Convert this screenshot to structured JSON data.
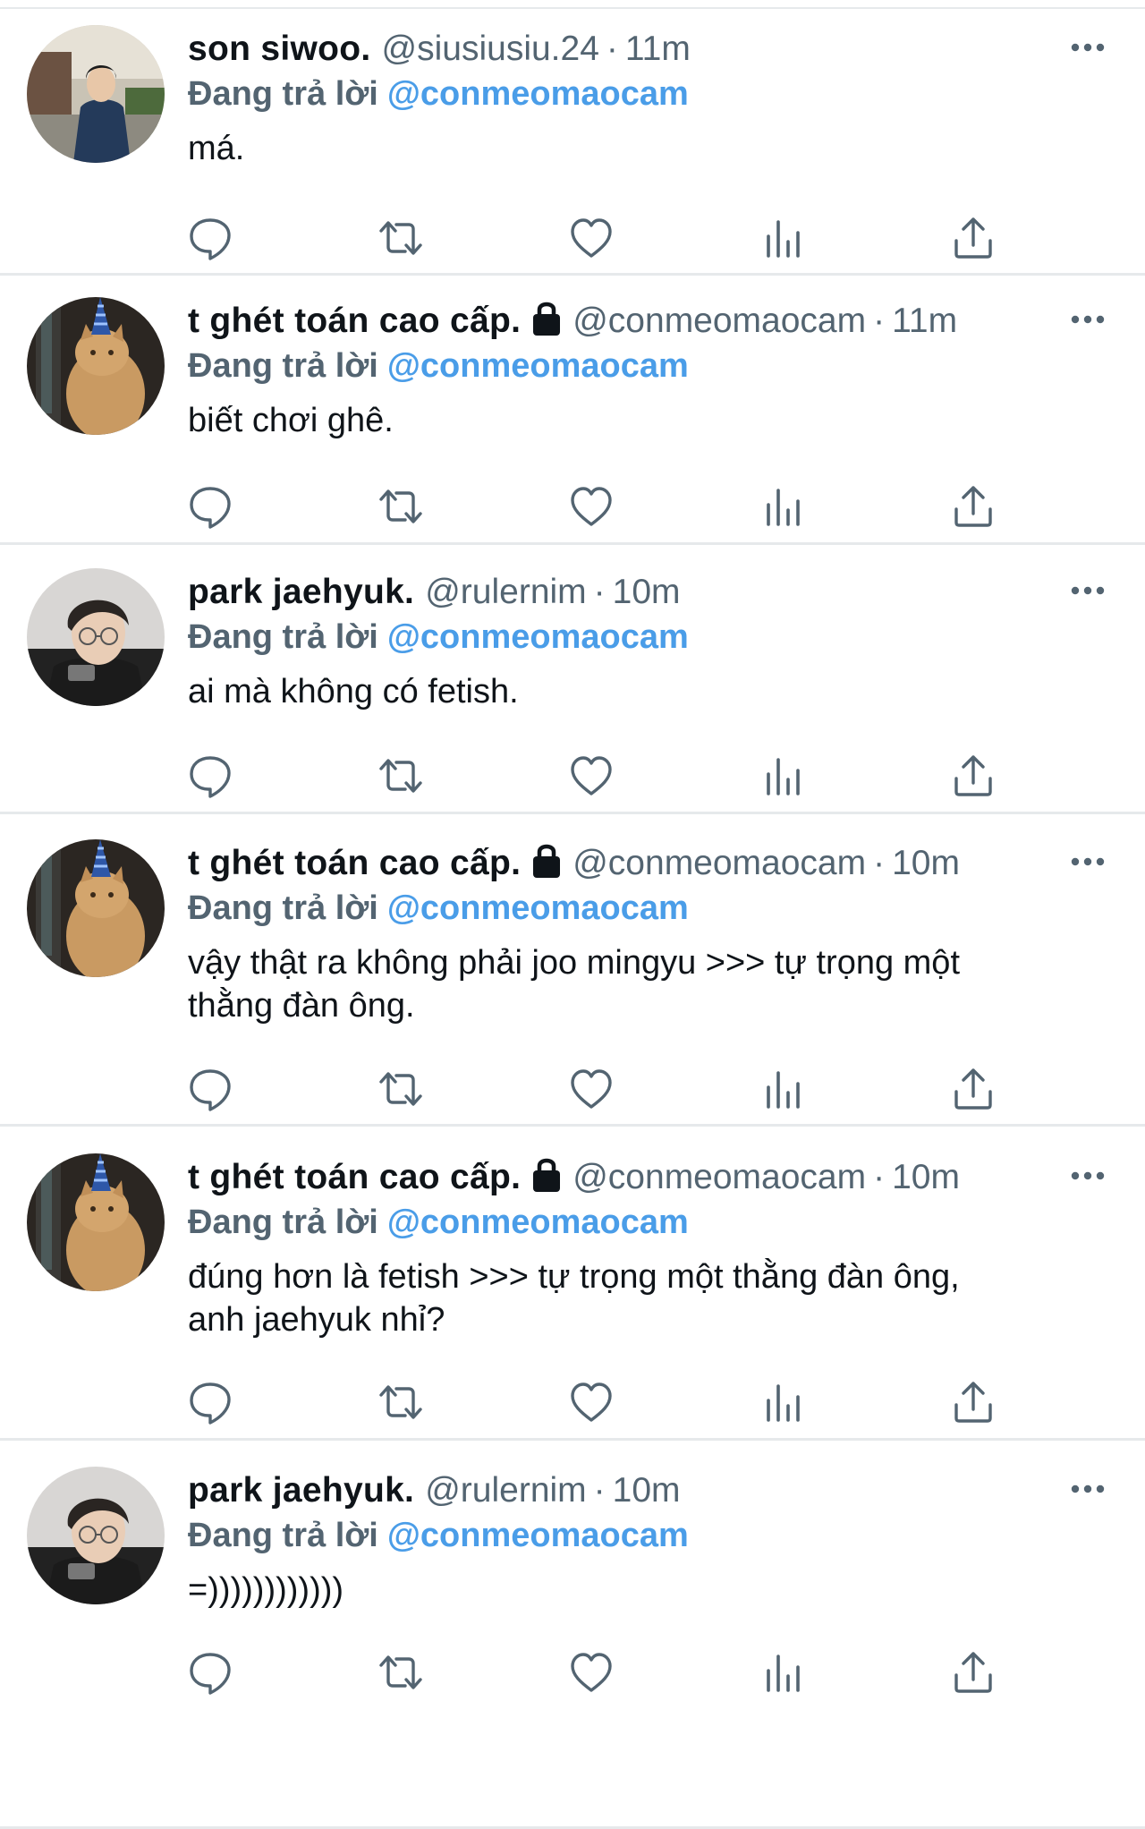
{
  "colors": {
    "link": "#4a9de8",
    "secondary_text": "#536471",
    "primary_text": "#0f1419",
    "icon": "#536471",
    "divider": "#e6e9eb"
  },
  "icons": {
    "more": "more-options-icon",
    "lock": "lock-icon",
    "reply": "reply-icon",
    "retweet": "retweet-icon",
    "like": "like-icon",
    "views": "views-icon",
    "share": "share-icon"
  },
  "tweets": [
    {
      "display_name": "son siwoo.",
      "protected": false,
      "handle": "@siusiusiu.24",
      "separator": "·",
      "time": "11m",
      "reply_prefix": "Đang trả lời",
      "reply_to": "@conmeomaocam",
      "text": "má.",
      "avatar": "siwoo"
    },
    {
      "display_name": "t ghét toán cao cấp.",
      "protected": true,
      "handle": "@conmeomaocam",
      "separator": "·",
      "time": "11m",
      "reply_prefix": "Đang trả lời",
      "reply_to": "@conmeomaocam",
      "text": "biết chơi ghê.",
      "avatar": "cat"
    },
    {
      "display_name": "park jaehyuk.",
      "protected": false,
      "handle": "@rulernim",
      "separator": "·",
      "time": "10m",
      "reply_prefix": "Đang trả lời",
      "reply_to": "@conmeomaocam",
      "text": "ai mà không có fetish.",
      "avatar": "jaehyuk"
    },
    {
      "display_name": "t ghét toán cao cấp.",
      "protected": true,
      "handle": "@conmeomaocam",
      "separator": "·",
      "time": "10m",
      "reply_prefix": "Đang trả lời",
      "reply_to": "@conmeomaocam",
      "text": "vậy thật ra không phải joo mingyu >>> tự trọng một\nthằng đàn ông.",
      "avatar": "cat"
    },
    {
      "display_name": "t ghét toán cao cấp.",
      "protected": true,
      "handle": "@conmeomaocam",
      "separator": "·",
      "time": "10m",
      "reply_prefix": "Đang trả lời",
      "reply_to": "@conmeomaocam",
      "text": "đúng hơn là fetish >>> tự trọng một thằng đàn ông,\nanh jaehyuk nhỉ?",
      "avatar": "cat"
    },
    {
      "display_name": "park jaehyuk.",
      "protected": false,
      "handle": "@rulernim",
      "separator": "·",
      "time": "10m",
      "reply_prefix": "Đang trả lời",
      "reply_to": "@conmeomaocam",
      "text": "=))))))))))))",
      "avatar": "jaehyuk"
    }
  ]
}
